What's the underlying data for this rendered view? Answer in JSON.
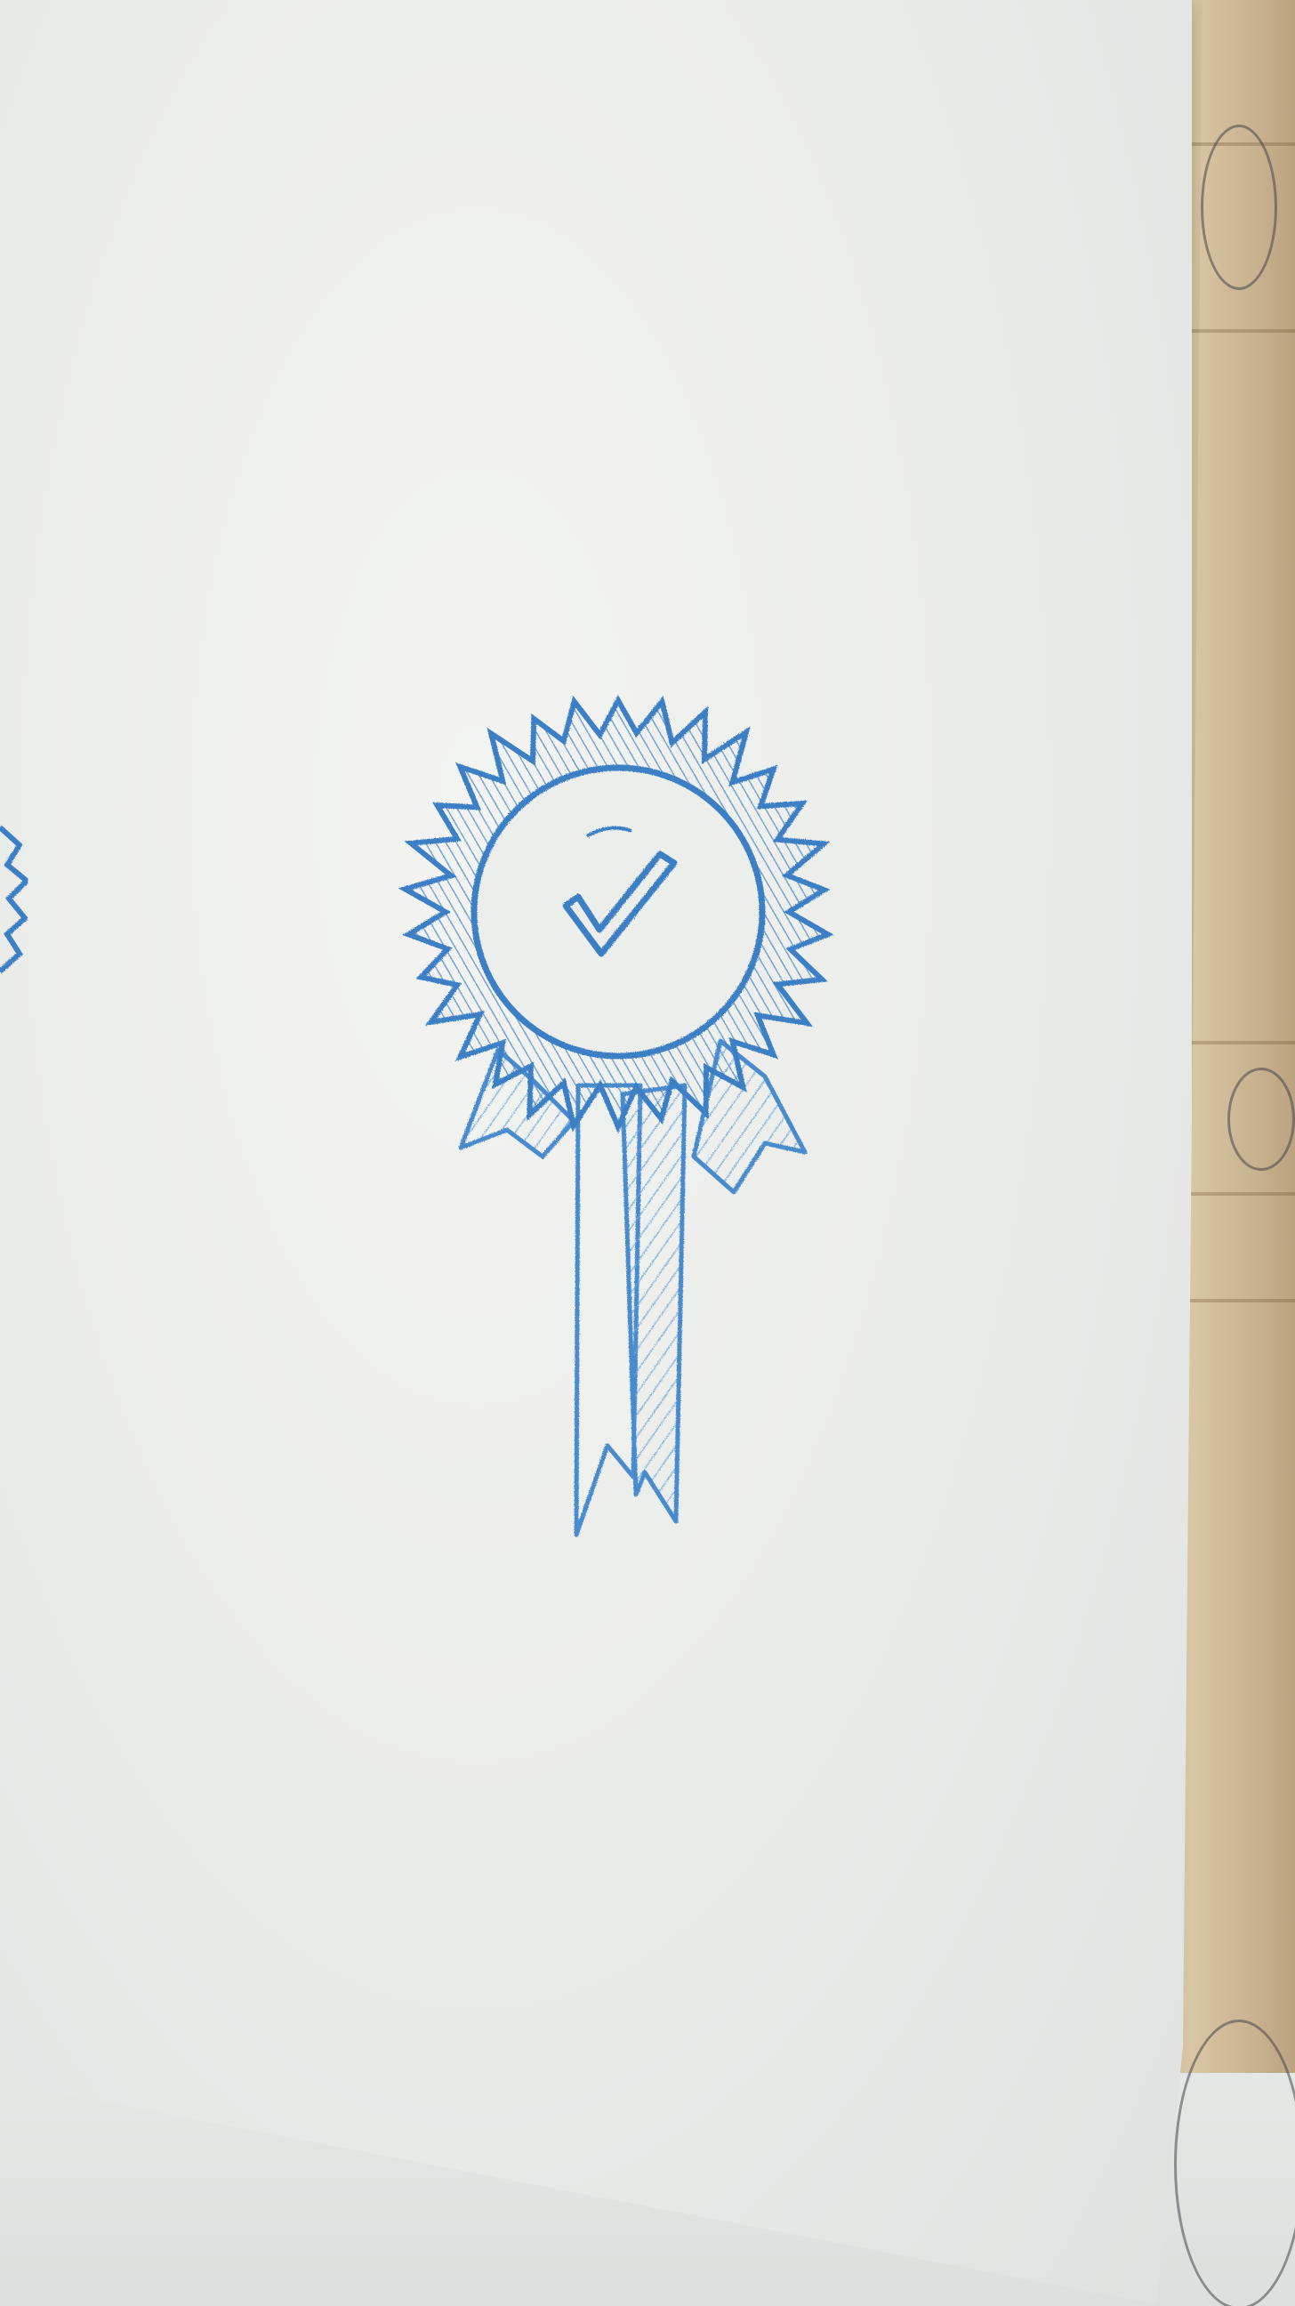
{
  "scene": {
    "subject": "rosette-award-badge",
    "ink_color": "#3d7fc4",
    "ink_light_color": "#7fb0de",
    "paper_color": "#eceeec"
  }
}
